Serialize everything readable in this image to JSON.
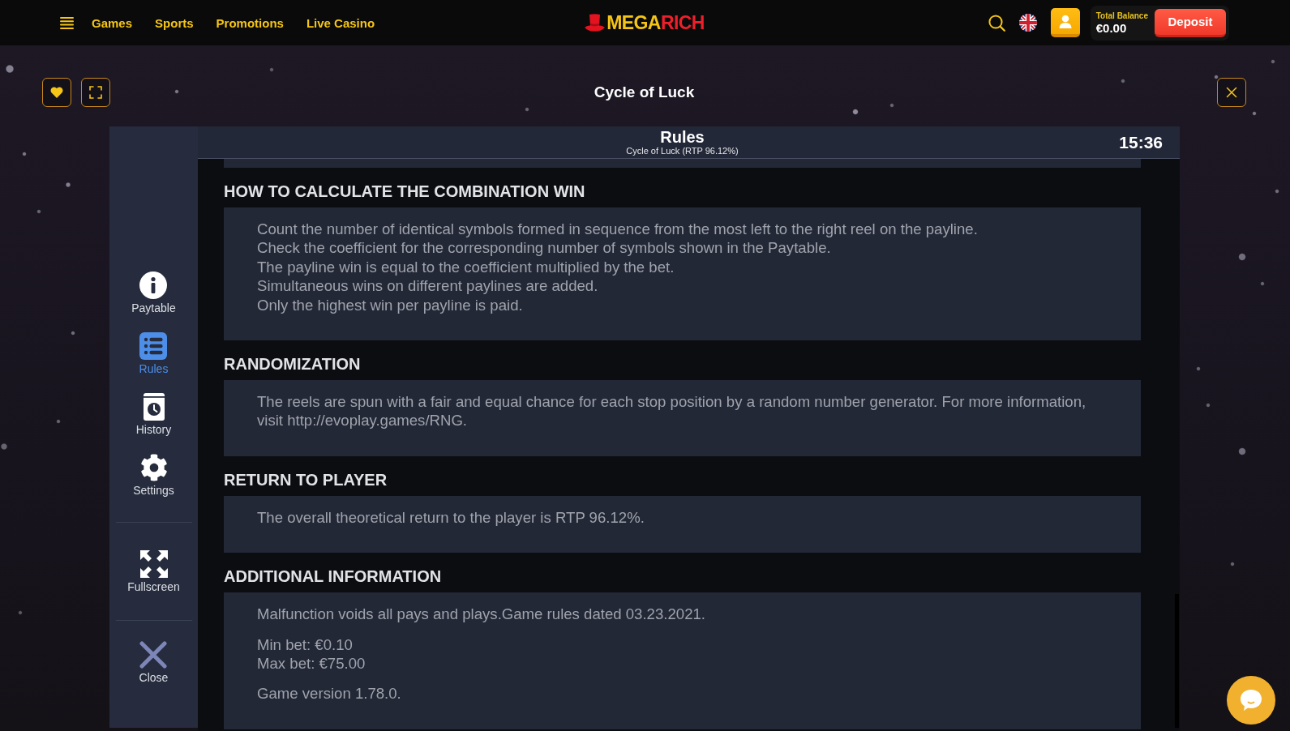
{
  "top_bar": {
    "nav": [
      "Games",
      "Sports",
      "Promotions",
      "Live Casino"
    ],
    "logo": [
      "MEGA",
      "RICH"
    ],
    "balance": {
      "label": "Total Balance",
      "amount": "€0.00"
    },
    "deposit_button": "Deposit"
  },
  "game": {
    "title": "Cycle of Luck"
  },
  "sidebar": {
    "items": [
      {
        "label": "Paytable",
        "kind": "info",
        "selected": false
      },
      {
        "label": "Rules",
        "kind": "list",
        "selected": true
      },
      {
        "label": "History",
        "kind": "history",
        "selected": false
      },
      {
        "label": "Settings",
        "kind": "settings",
        "selected": false
      }
    ],
    "tools": [
      {
        "label": "Fullscreen",
        "kind": "expand"
      },
      {
        "label": "Close",
        "kind": "close"
      }
    ]
  },
  "rules_panel": {
    "title": "Rules",
    "subtitle": "Cycle of Luck (RTP 96.12%)",
    "time": "15:36",
    "sections": [
      {
        "heading": "HOW TO CALCULATE THE COMBINATION WIN",
        "paragraphs": [
          {
            "lines": [
              "Count the number of identical symbols formed in sequence from the most left to the right reel on the payline.",
              "Check the coefficient for the corresponding number of symbols shown in the Paytable.",
              "The payline win is equal to the coefficient multiplied by the bet.",
              "Simultaneous wins on different paylines are added.",
              "Only the highest win per payline is paid."
            ]
          }
        ]
      },
      {
        "heading": "RANDOMIZATION",
        "paragraphs": [
          {
            "lines": [
              "The reels are spun with a fair and equal chance for each stop position by a random number generator. For more information, visit http://evoplay.games/RNG."
            ]
          }
        ]
      },
      {
        "heading": "RETURN TO PLAYER",
        "paragraphs": [
          {
            "lines": [
              "The overall theoretical return to the player is RTP 96.12%."
            ]
          }
        ]
      },
      {
        "heading": "ADDITIONAL INFORMATION",
        "paragraphs": [
          {
            "lines": [
              "Malfunction voids all pays and plays.Game rules dated 03.23.2021."
            ]
          },
          {
            "lines": [
              "Min bet: €0.10",
              "Max bet: €75.00"
            ]
          },
          {
            "lines": [
              "Game version 1.78.0."
            ]
          }
        ]
      }
    ]
  }
}
